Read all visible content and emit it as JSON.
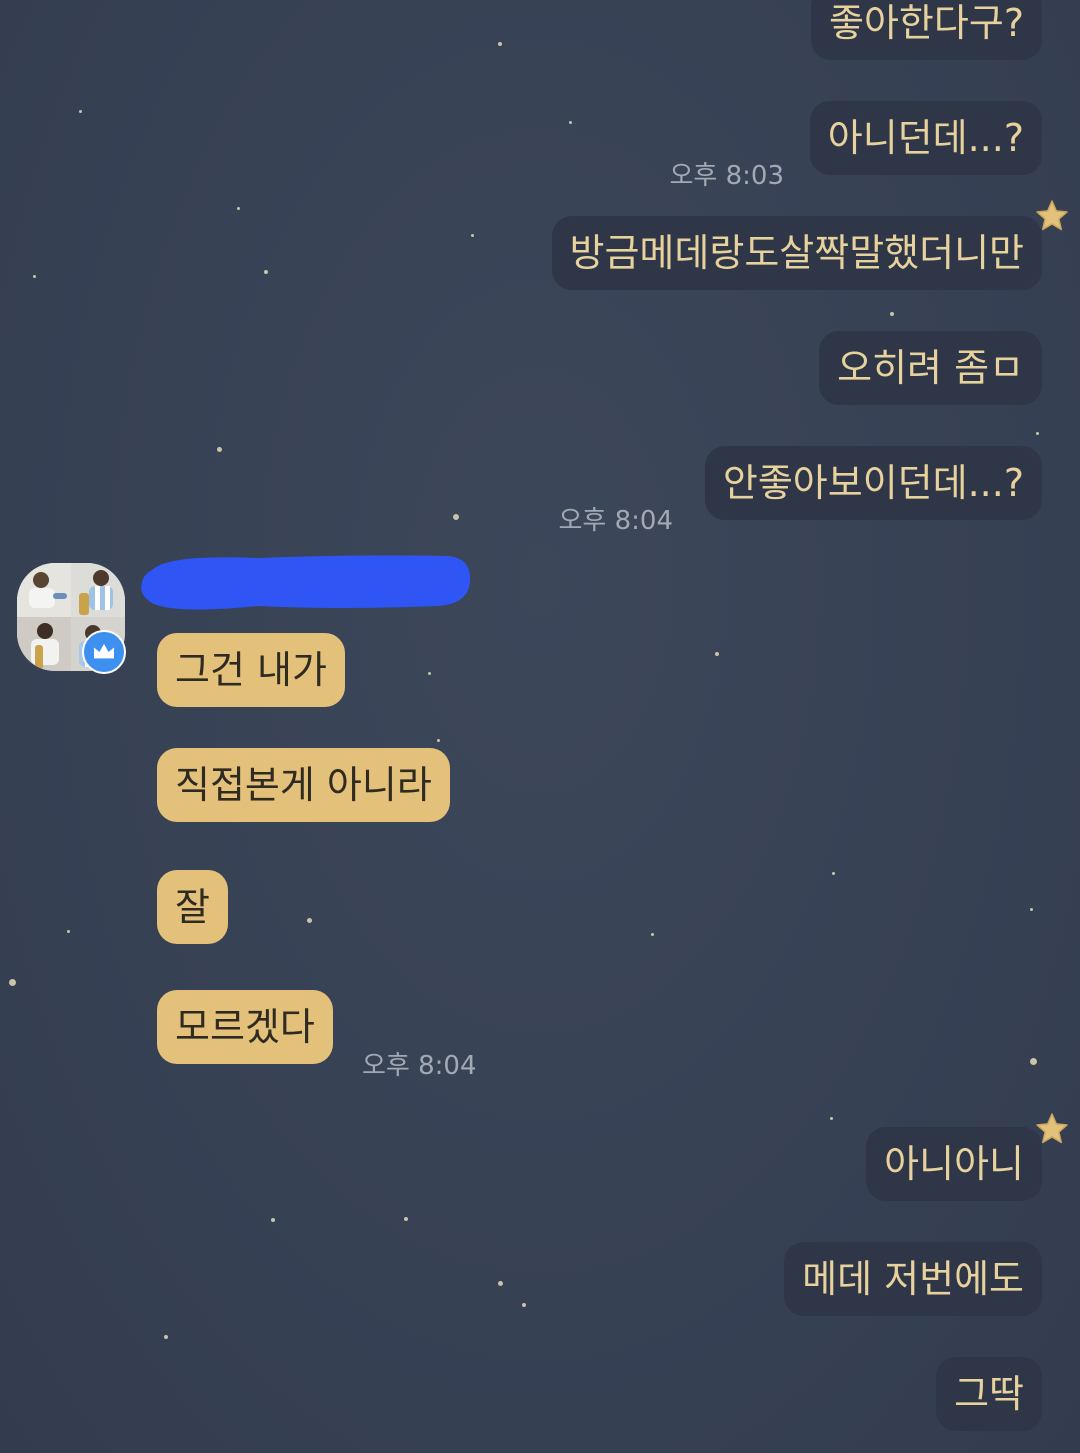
{
  "theme": {
    "background": "#3a4456",
    "outgoing_bubble": "#2e3648",
    "outgoing_text": "#e7d19c",
    "incoming_bubble": "#e3c17a",
    "incoming_text": "#2f2b23",
    "time_text": "#a3a8b3",
    "star_accent": "#e3c17a",
    "badge_blue": "#3d8ff0",
    "redaction_blue": "#2f55f5"
  },
  "messages": [
    {
      "direction": "outgoing",
      "text": "좋아한다구?"
    },
    {
      "direction": "outgoing",
      "text": "아니던데...?",
      "time": "오후 8:03"
    },
    {
      "direction": "outgoing",
      "text": "방금메데랑도살짝말했더니만"
    },
    {
      "direction": "outgoing",
      "text": "오히려 좀ㅁ"
    },
    {
      "direction": "outgoing",
      "text": "안좋아보이던데...?",
      "time": "오후 8:04"
    },
    {
      "direction": "incoming",
      "text": "그건 내가"
    },
    {
      "direction": "incoming",
      "text": "직접본게 아니라"
    },
    {
      "direction": "incoming",
      "text": "잘"
    },
    {
      "direction": "incoming",
      "text": "모르겠다",
      "time": "오후 8:04"
    },
    {
      "direction": "outgoing",
      "text": "아니아니"
    },
    {
      "direction": "outgoing",
      "text": "메데 저번에도"
    },
    {
      "direction": "outgoing",
      "text": "그딱"
    }
  ],
  "sender": {
    "avatar_icon": "profile-photo",
    "badge_icon": "crown-icon",
    "name_redacted": true
  }
}
